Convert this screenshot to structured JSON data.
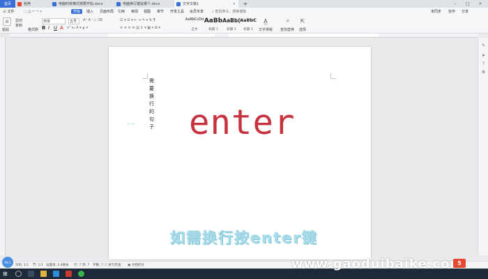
{
  "tabs": {
    "home": "首页",
    "daoke": "稻壳",
    "doc1": "电脑时候横式按要开始.docx",
    "doc2": "电脑换行键是哪个.docx",
    "doc3": "文字文稿1"
  },
  "menubar": {
    "file": "三 文件",
    "items": [
      "开始",
      "插入",
      "页面布局",
      "引用",
      "审阅",
      "视图",
      "章节",
      "开发工具",
      "会员专享"
    ],
    "search": "查找命令、搜索模板",
    "sync": "未同步",
    "collab": "协作",
    "share": "分享"
  },
  "ribbon": {
    "paste": "粘贴",
    "cut": "剪切",
    "copy": "复制",
    "format_painter": "格式刷",
    "font_name": "宋体",
    "font_size": "五号",
    "styles": [
      {
        "sample": "AaBbCcDd",
        "name": "正文"
      },
      {
        "sample": "AaBb",
        "name": "标题 1"
      },
      {
        "sample": "AaBb(",
        "name": "标题 2"
      },
      {
        "sample": "AaBbC",
        "name": "标题 3"
      }
    ],
    "text_tools": "文字排版",
    "find_replace": "查找替换",
    "select": "选择"
  },
  "document": {
    "vertical_text": "需要换行的句子",
    "main_text": "enter",
    "caption": "如需换行按enter键"
  },
  "statusbar": {
    "page": "页码: 1/1",
    "section": "节: 1/1",
    "setting": "设置值: 5.8厘米",
    "row": "行: 7",
    "col": "列: 7",
    "words": "字数: 7",
    "spell": "拼写检查",
    "compare": "文档校对",
    "avatar": "09.1"
  },
  "watermark": "www.gaoduibaike.com",
  "watermark_logo": "5",
  "colors": {
    "accent": "#3b6fd8",
    "enter_text": "#c8323f",
    "caption": "#a9dbe8",
    "taskbar": "#1e2a3a"
  }
}
